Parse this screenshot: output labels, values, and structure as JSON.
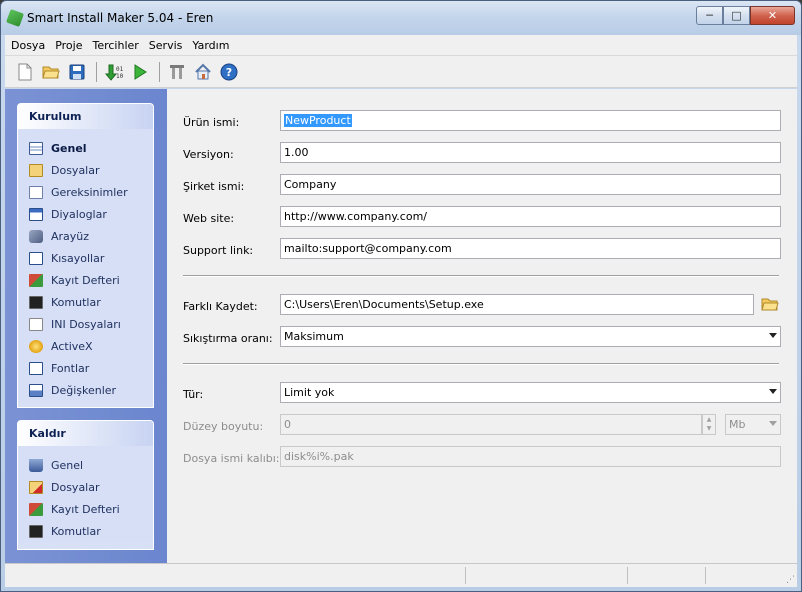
{
  "window": {
    "title": "Smart Install Maker 5.04 - Eren",
    "minimize_glyph": "─",
    "maximize_glyph": "□",
    "close_glyph": "✕"
  },
  "menu": [
    "Dosya",
    "Proje",
    "Tercihler",
    "Servis",
    "Yardım"
  ],
  "toolbar": {
    "icons": [
      "new-file-icon",
      "open-folder-icon",
      "save-icon",
      "build-icon",
      "run-icon",
      "tools-icon",
      "home-icon",
      "help-icon"
    ]
  },
  "sidebar": {
    "install_panel": {
      "title": "Kurulum",
      "items": [
        {
          "label": "Genel",
          "icon": "general-icon",
          "active": true
        },
        {
          "label": "Dosyalar",
          "icon": "files-icon"
        },
        {
          "label": "Gereksinimler",
          "icon": "requirements-icon"
        },
        {
          "label": "Diyaloglar",
          "icon": "dialogs-icon"
        },
        {
          "label": "Arayüz",
          "icon": "interface-icon"
        },
        {
          "label": "Kısayollar",
          "icon": "shortcuts-icon"
        },
        {
          "label": "Kayıt Defteri",
          "icon": "registry-icon"
        },
        {
          "label": "Komutlar",
          "icon": "commands-icon"
        },
        {
          "label": "INI Dosyaları",
          "icon": "ini-files-icon"
        },
        {
          "label": "ActiveX",
          "icon": "activex-icon"
        },
        {
          "label": "Fontlar",
          "icon": "fonts-icon"
        },
        {
          "label": "Değişkenler",
          "icon": "variables-icon"
        }
      ]
    },
    "uninstall_panel": {
      "title": "Kaldır",
      "items": [
        {
          "label": "Genel",
          "icon": "uninstall-general-icon"
        },
        {
          "label": "Dosyalar",
          "icon": "uninstall-files-icon"
        },
        {
          "label": "Kayıt Defteri",
          "icon": "uninstall-registry-icon"
        },
        {
          "label": "Komutlar",
          "icon": "uninstall-commands-icon"
        }
      ]
    }
  },
  "form": {
    "product_name": {
      "label": "Ürün ismi:",
      "value": "NewProduct"
    },
    "version": {
      "label": "Versiyon:",
      "value": "1.00"
    },
    "company": {
      "label": "Şirket ismi:",
      "value": "Company"
    },
    "website": {
      "label": "Web site:",
      "value": "http://www.company.com/"
    },
    "support": {
      "label": "Support link:",
      "value": "mailto:support@company.com"
    },
    "save_as": {
      "label": "Farklı Kaydet:",
      "value": "C:\\Users\\Eren\\Documents\\Setup.exe"
    },
    "compression": {
      "label": "Sıkıştırma oranı:",
      "value": "Maksimum"
    },
    "type": {
      "label": "Tür:",
      "value": "Limit yok"
    },
    "volume_size": {
      "label": "Düzey boyutu:",
      "value": "0",
      "unit": "Mb"
    },
    "file_name_template": {
      "label": "Dosya ismi kalıbı:",
      "value": "disk%i%.pak"
    }
  },
  "colors": {
    "sidebar_bg": "#7b93d4",
    "panel_bg": "#d6dff5",
    "selection": "#3399ff",
    "panel_header_text": "#0e2354"
  }
}
